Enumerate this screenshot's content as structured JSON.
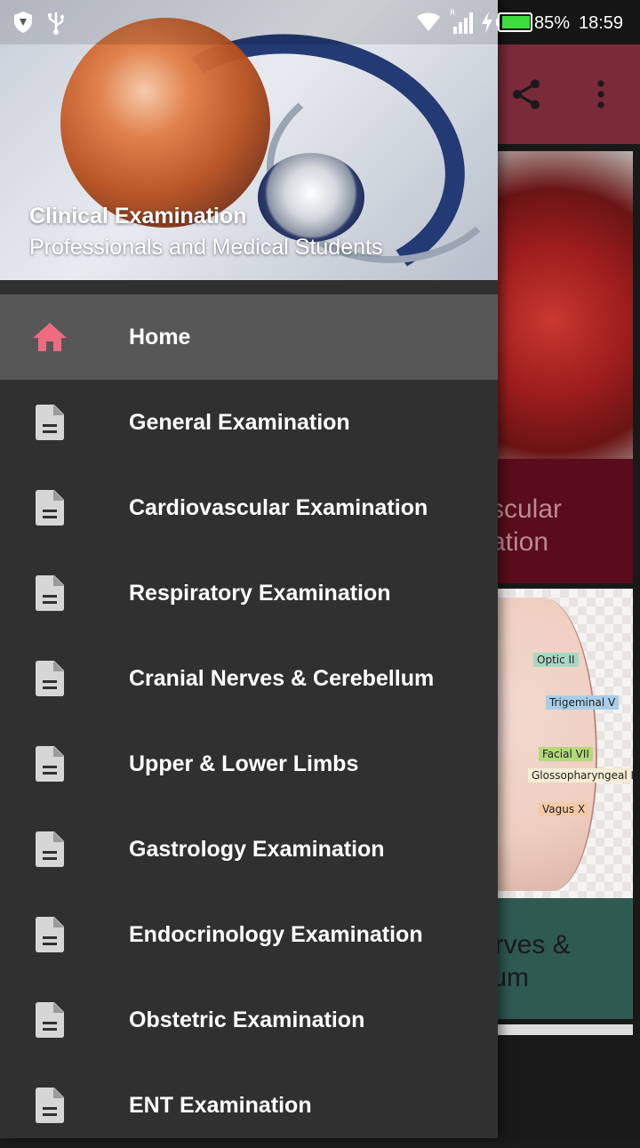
{
  "status_bar": {
    "battery_percent": "85%",
    "time": "18:59",
    "icons": [
      "shield-icon",
      "usb-icon",
      "wifi-icon",
      "signal-icon",
      "charging-icon",
      "battery-icon"
    ]
  },
  "app_toolbar": {
    "actions": [
      "share-icon",
      "more-vert-icon"
    ]
  },
  "background_cards": [
    {
      "label_line1": "scular",
      "label_line2": "ation"
    },
    {
      "label_line1": "erves &",
      "label_line2": "llum",
      "diagram_labels": [
        "Optic II",
        "Trigeminal V",
        "Facial VII",
        "Glossopharyngeal IX",
        "Vagus X"
      ]
    }
  ],
  "drawer": {
    "header": {
      "title": "Clinical Examination",
      "subtitle": "Professionals and Medical Students"
    },
    "items": [
      {
        "label": "Home",
        "icon": "home-icon",
        "active": true
      },
      {
        "label": "General Examination",
        "icon": "document-icon"
      },
      {
        "label": "Cardiovascular Examination",
        "icon": "document-icon"
      },
      {
        "label": "Respiratory Examination",
        "icon": "document-icon"
      },
      {
        "label": "Cranial Nerves & Cerebellum",
        "icon": "document-icon"
      },
      {
        "label": "Upper & Lower Limbs",
        "icon": "document-icon"
      },
      {
        "label": "Gastrology Examination",
        "icon": "document-icon"
      },
      {
        "label": "Endocrinology Examination",
        "icon": "document-icon"
      },
      {
        "label": "Obstetric Examination",
        "icon": "document-icon"
      },
      {
        "label": "ENT Examination",
        "icon": "document-icon"
      }
    ]
  },
  "colors": {
    "toolbar": "#7b2a3a",
    "drawer_bg": "#303030",
    "active_item_bg": "#575757",
    "home_icon": "#ec6b80",
    "doc_icon": "#d6d6d6",
    "battery_fill": "#3ddc3d"
  }
}
